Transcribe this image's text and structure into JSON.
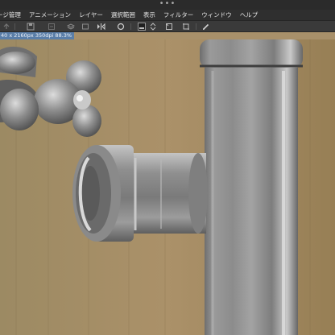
{
  "window": {
    "handle_dots": "•••"
  },
  "menu": {
    "items": [
      {
        "label": "ージ管理"
      },
      {
        "label": "アニメーション"
      },
      {
        "label": "レイヤー"
      },
      {
        "label": "選択範囲"
      },
      {
        "label": "表示"
      },
      {
        "label": "フィルター"
      },
      {
        "label": "ウィンドウ"
      },
      {
        "label": "ヘルプ"
      }
    ]
  },
  "document": {
    "info": "40 x 2160px 350dpi 88.3%"
  },
  "toolbar": {
    "tools": [
      "undo-icon",
      "save-icon",
      "save-copy-icon",
      "layer-icon",
      "clear-icon",
      "flip-horizontal-icon",
      "rotate-icon",
      "color-swatch-icon",
      "stepper-icon",
      "transform-icon",
      "crop-icon",
      "pen-icon"
    ]
  },
  "colors": {
    "background": "#a8906a",
    "menubar": "#2f2f2f",
    "toolbar": "#3a3a3a",
    "docinfo": "#5a7ea8",
    "pipe_gray": "#8d8d8d"
  }
}
